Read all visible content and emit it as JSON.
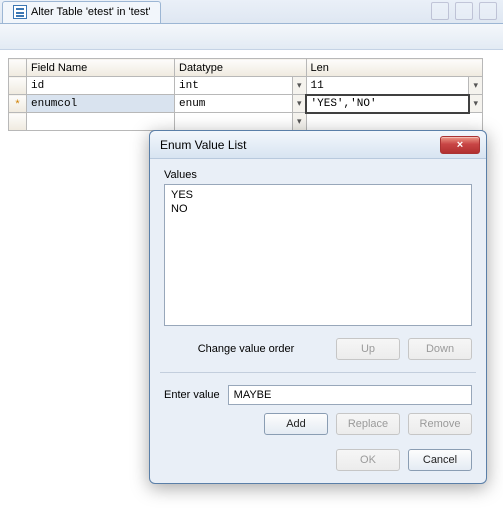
{
  "tab": {
    "title": "Alter Table 'etest' in 'test'"
  },
  "grid": {
    "headers": {
      "field": "Field Name",
      "datatype": "Datatype",
      "len": "Len"
    },
    "rows": [
      {
        "marker": "",
        "field": "id",
        "datatype": "int",
        "len": "11",
        "editing": false
      },
      {
        "marker": "*",
        "field": "enumcol",
        "datatype": "enum",
        "len": "'YES','NO'",
        "editing": true
      }
    ]
  },
  "dialog": {
    "title": "Enum Value List",
    "values_label": "Values",
    "values": [
      "YES",
      "NO"
    ],
    "order_label": "Change value order",
    "up": "Up",
    "down": "Down",
    "enter_label": "Enter value",
    "enter_value": "MAYBE",
    "add": "Add",
    "replace": "Replace",
    "remove": "Remove",
    "ok": "OK",
    "cancel": "Cancel",
    "close_glyph": "×"
  }
}
